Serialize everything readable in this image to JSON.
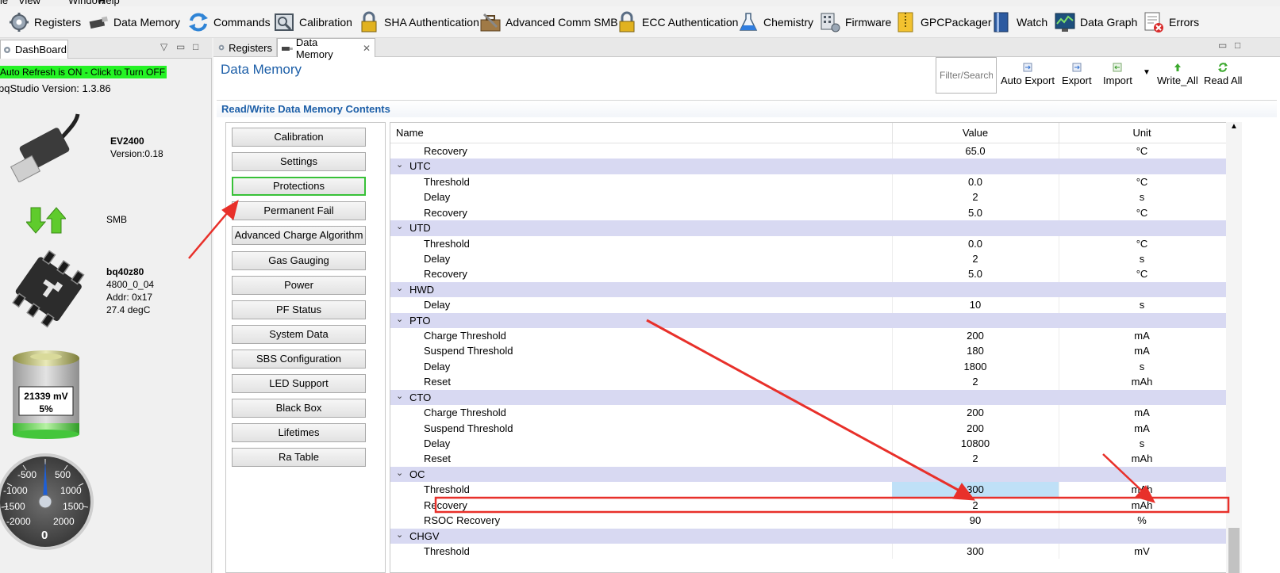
{
  "menu": [
    "le",
    "View",
    "Window",
    "Help"
  ],
  "toolbar": [
    {
      "label": "Registers",
      "icon": "gear-icon"
    },
    {
      "label": "Data Memory",
      "icon": "usb-stick-icon"
    },
    {
      "label": "Commands",
      "icon": "refresh-arrows-icon"
    },
    {
      "label": "Calibration",
      "icon": "calibration-icon"
    },
    {
      "label": "SHA Authentication",
      "icon": "lock-icon"
    },
    {
      "label": "Advanced Comm SMB",
      "icon": "toolbox-icon"
    },
    {
      "label": "ECC Authentication",
      "icon": "lock-icon"
    },
    {
      "label": "Chemistry",
      "icon": "flask-icon"
    },
    {
      "label": "Firmware",
      "icon": "chip-gear-icon"
    },
    {
      "label": "GPCPackager",
      "icon": "zip-folder-icon"
    },
    {
      "label": "Watch",
      "icon": "book-icon"
    },
    {
      "label": "Data Graph",
      "icon": "graph-monitor-icon"
    },
    {
      "label": "Errors",
      "icon": "error-list-icon"
    }
  ],
  "dashboard": {
    "tab": "DashBoard",
    "auto_refresh": "Auto Refresh is ON - Click to Turn OFF",
    "version": "bqStudio Version:  1.3.86",
    "adapter": {
      "name": "EV2400",
      "version": "Version:0.18"
    },
    "bus": "SMB",
    "device": {
      "name": "bq40z80",
      "fw": "4800_0_04",
      "addr": "Addr: 0x17",
      "temp": "27.4 degC"
    },
    "battery": {
      "voltage": "21339 mV",
      "soc": "5%",
      "soc_fraction": 0.05
    },
    "gauge": {
      "ticks": [
        "-500",
        "500",
        "-1000",
        "1000",
        "-1500",
        "1500",
        "-2000",
        "2000"
      ],
      "value": "0"
    }
  },
  "editor": {
    "tabs": [
      "Registers",
      "Data Memory"
    ],
    "title": "Data Memory",
    "filter_placeholder": "Filter/Search",
    "actions": [
      "Auto Export",
      "Export",
      "Import",
      "Write_All",
      "Read All"
    ],
    "section": "Read/Write Data Memory Contents"
  },
  "categories": [
    "Calibration",
    "Settings",
    "Protections",
    "Permanent Fail",
    "Advanced Charge Algorithm",
    "Gas Gauging",
    "Power",
    "PF Status",
    "System Data",
    "SBS Configuration",
    "LED Support",
    "Black Box",
    "Lifetimes",
    "Ra Table"
  ],
  "selected_category": "Protections",
  "table": {
    "headers": {
      "name": "Name",
      "value": "Value",
      "unit": "Unit"
    },
    "rows": [
      {
        "name": "Recovery",
        "value": "65.0",
        "unit": "°C"
      },
      {
        "group": "UTC"
      },
      {
        "name": "Threshold",
        "value": "0.0",
        "unit": "°C"
      },
      {
        "name": "Delay",
        "value": "2",
        "unit": "s"
      },
      {
        "name": "Recovery",
        "value": "5.0",
        "unit": "°C"
      },
      {
        "group": "UTD"
      },
      {
        "name": "Threshold",
        "value": "0.0",
        "unit": "°C"
      },
      {
        "name": "Delay",
        "value": "2",
        "unit": "s"
      },
      {
        "name": "Recovery",
        "value": "5.0",
        "unit": "°C"
      },
      {
        "group": "HWD"
      },
      {
        "name": "Delay",
        "value": "10",
        "unit": "s"
      },
      {
        "group": "PTO"
      },
      {
        "name": "Charge Threshold",
        "value": "200",
        "unit": "mA"
      },
      {
        "name": "Suspend Threshold",
        "value": "180",
        "unit": "mA"
      },
      {
        "name": "Delay",
        "value": "1800",
        "unit": "s"
      },
      {
        "name": "Reset",
        "value": "2",
        "unit": "mAh"
      },
      {
        "group": "CTO"
      },
      {
        "name": "Charge Threshold",
        "value": "200",
        "unit": "mA"
      },
      {
        "name": "Suspend Threshold",
        "value": "200",
        "unit": "mA"
      },
      {
        "name": "Delay",
        "value": "10800",
        "unit": "s"
      },
      {
        "name": "Reset",
        "value": "2",
        "unit": "mAh"
      },
      {
        "group": "OC"
      },
      {
        "name": "Threshold",
        "value": "300",
        "unit": "mAh",
        "selected": true
      },
      {
        "name": "Recovery",
        "value": "2",
        "unit": "mAh"
      },
      {
        "name": "RSOC Recovery",
        "value": "90",
        "unit": "%"
      },
      {
        "group": "CHGV"
      },
      {
        "name": "Threshold",
        "value": "300",
        "unit": "mV"
      }
    ]
  },
  "colors": {
    "accent": "#1d5fa8",
    "group_row": "#d8d9f2",
    "auto_refresh": "#24f324",
    "annotation": "#e8302a",
    "selected_button": "#38c138"
  }
}
